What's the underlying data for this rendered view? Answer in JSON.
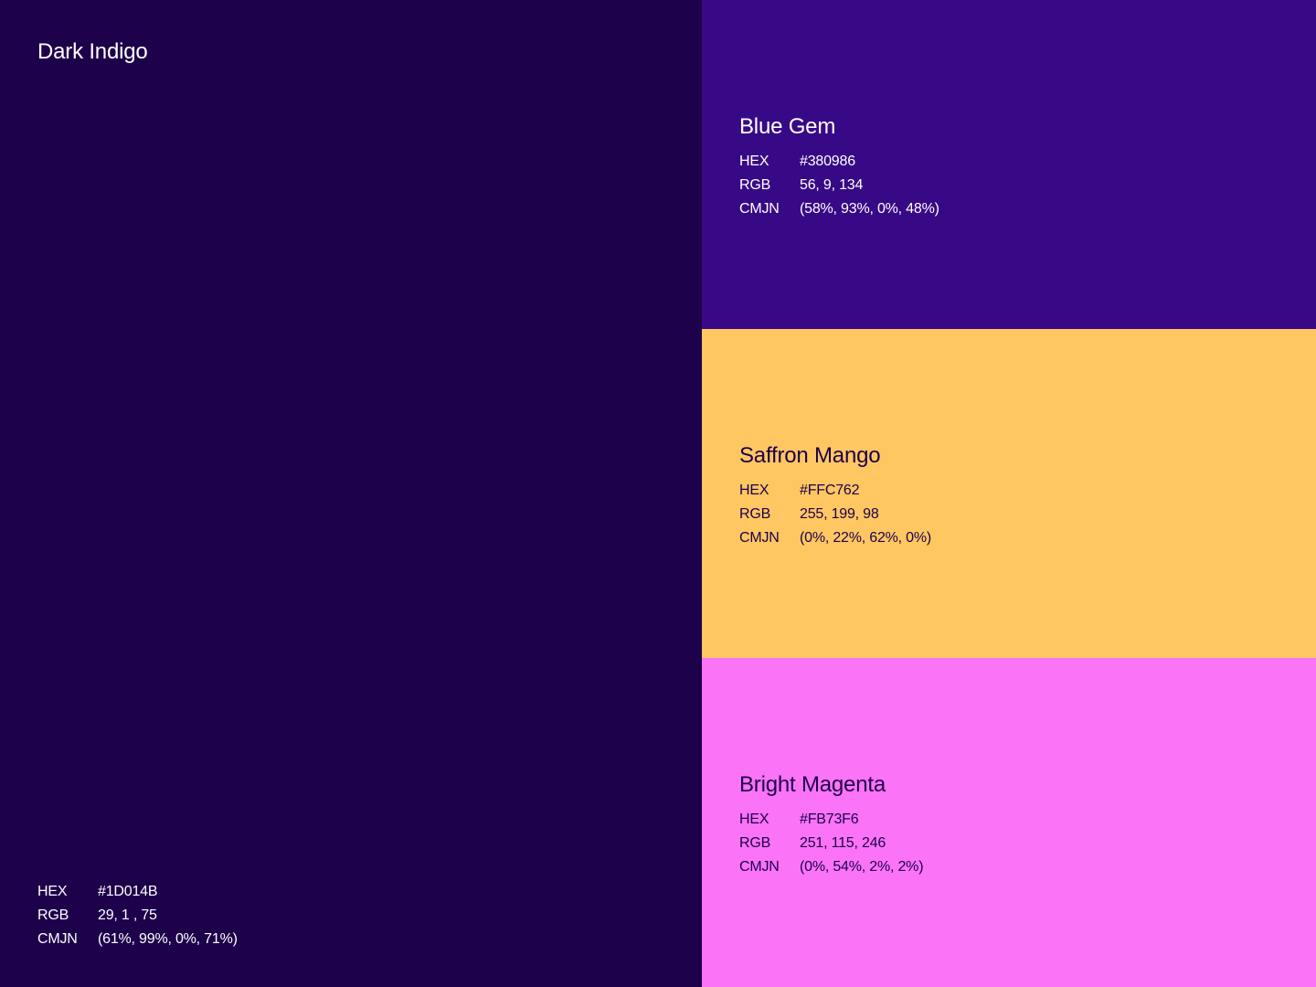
{
  "colors": {
    "dark_indigo_bg": "#1D014B",
    "blue_gem_bg": "#380986",
    "saffron_mango_bg": "#FFC762",
    "bright_magenta_bg": "#FB73F6",
    "light_text": "#FFFFFF",
    "dark_text": "#1D014B"
  },
  "swatches": [
    {
      "name": "Dark Indigo",
      "hex_label": "HEX",
      "hex": "#1D014B",
      "rgb_label": "RGB",
      "rgb": "29, 1 , 75",
      "cmjn_label": "CMJN",
      "cmjn": "(61%, 99%, 0%, 71%)"
    },
    {
      "name": "Blue Gem",
      "hex_label": "HEX",
      "hex": "#380986",
      "rgb_label": "RGB",
      "rgb": "56, 9, 134",
      "cmjn_label": "CMJN",
      "cmjn": "(58%, 93%, 0%, 48%)"
    },
    {
      "name": "Saffron Mango",
      "hex_label": "HEX",
      "hex": "#FFC762",
      "rgb_label": "RGB",
      "rgb": "255, 199, 98",
      "cmjn_label": "CMJN",
      "cmjn": "(0%, 22%, 62%, 0%)"
    },
    {
      "name": "Bright Magenta",
      "hex_label": "HEX",
      "hex": "#FB73F6",
      "rgb_label": "RGB",
      "rgb": "251, 115, 246",
      "cmjn_label": "CMJN",
      "cmjn": "(0%, 54%, 2%, 2%)"
    }
  ]
}
